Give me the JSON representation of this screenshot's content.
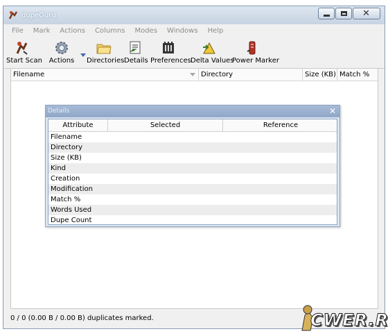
{
  "window": {
    "title": "dupeGuru"
  },
  "menu": [
    "File",
    "Mark",
    "Actions",
    "Columns",
    "Modes",
    "Windows",
    "Help"
  ],
  "toolbar": {
    "start_scan": "Start Scan",
    "actions": "Actions",
    "directories": "Directories",
    "details": "Details",
    "preferences": "Preferences",
    "delta_values": "Delta Values",
    "power_marker": "Power Marker"
  },
  "results": {
    "columns": [
      "Filename",
      "Directory",
      "Size (KB)",
      "Match %"
    ]
  },
  "details_panel": {
    "title": "Details",
    "columns": [
      "Attribute",
      "Selected",
      "Reference"
    ],
    "rows": [
      "Filename",
      "Directory",
      "Size (KB)",
      "Kind",
      "Creation",
      "Modification",
      "Match %",
      "Words Used",
      "Dupe Count"
    ]
  },
  "status": {
    "text": "0 / 0 (0.00 B / 0.00 B) duplicates marked."
  },
  "watermark": {
    "text": "CWER.RU"
  }
}
